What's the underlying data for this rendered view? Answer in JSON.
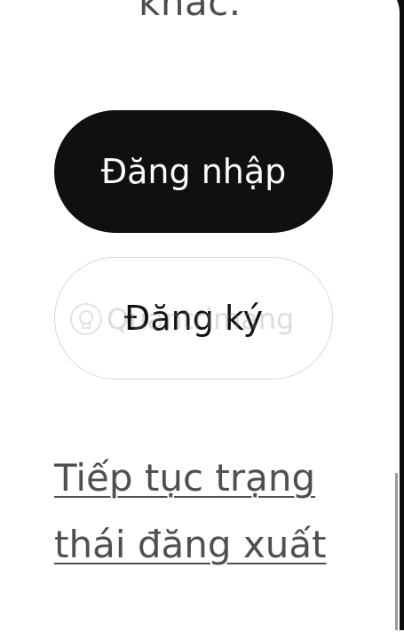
{
  "header": {
    "heading_tail": "khác."
  },
  "actions": {
    "login_label": "Đăng nhập",
    "signup_label": "Đăng ký"
  },
  "links": {
    "continue_logged_out": "Tiếp tục trạng thái đăng xuất"
  },
  "watermark": {
    "text": "Quantrimang"
  },
  "colors": {
    "primary_button_bg": "#101010",
    "primary_button_text": "#ffffff",
    "secondary_button_border": "#d9d9d9",
    "link_text": "#4f4f4f"
  }
}
